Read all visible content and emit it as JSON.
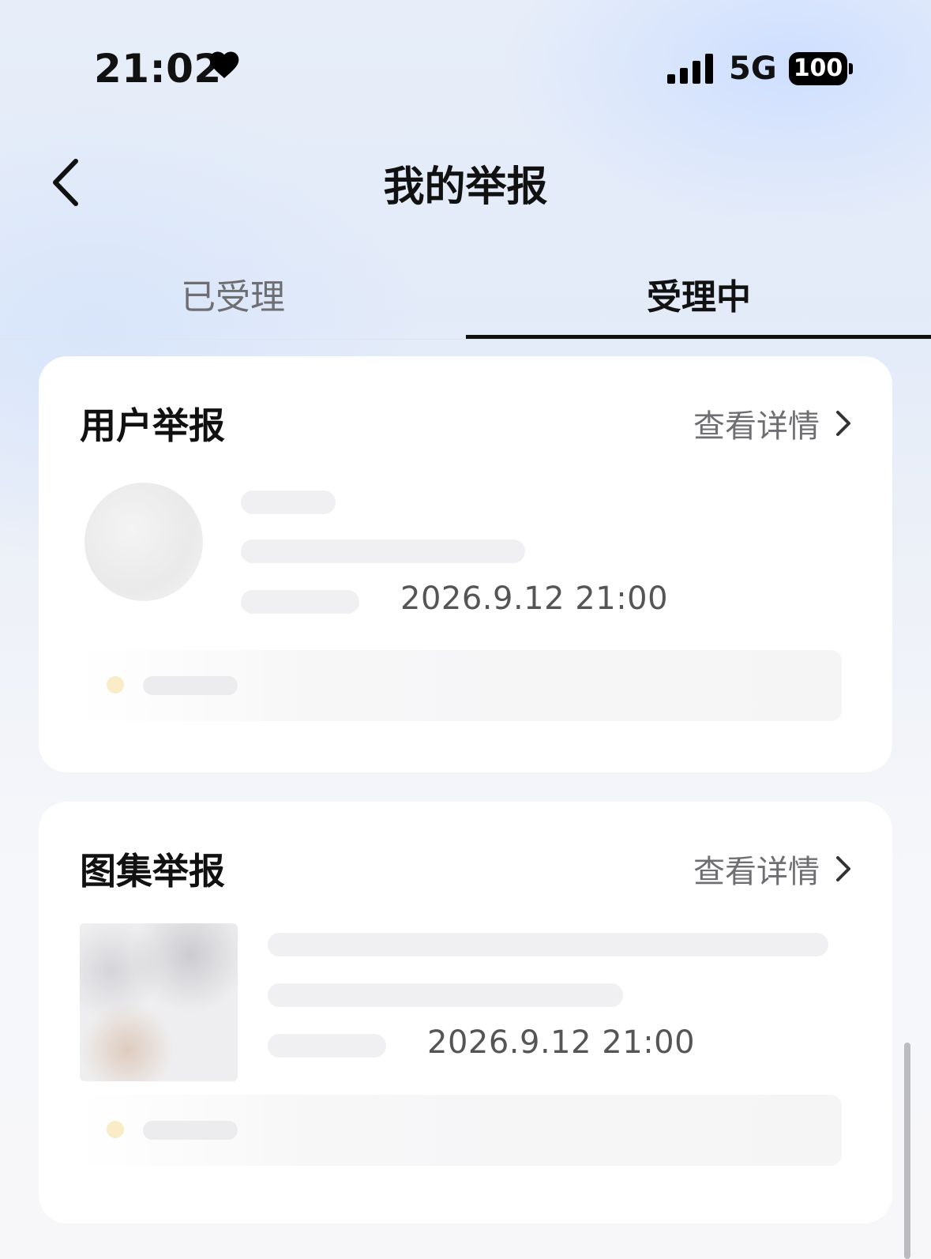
{
  "status_bar": {
    "time": "21:02",
    "heart_icon": "heart-icon",
    "network": "5G",
    "battery": "100"
  },
  "header": {
    "title": "我的举报",
    "back_icon": "chevron-left-icon"
  },
  "tabs": [
    {
      "label": "已受理",
      "active": false
    },
    {
      "label": "受理中",
      "active": true
    }
  ],
  "cards": [
    {
      "title": "用户举报",
      "detail_label": "查看详情",
      "report_time": "2026.9.12 21:00"
    },
    {
      "title": "图集举报",
      "detail_label": "查看详情",
      "report_time": "2026.9.12 21:00"
    }
  ],
  "colors": {
    "active_tab_underline": "#111111",
    "inactive_tab_text": "#6e6e72",
    "card_background": "#ffffff"
  }
}
